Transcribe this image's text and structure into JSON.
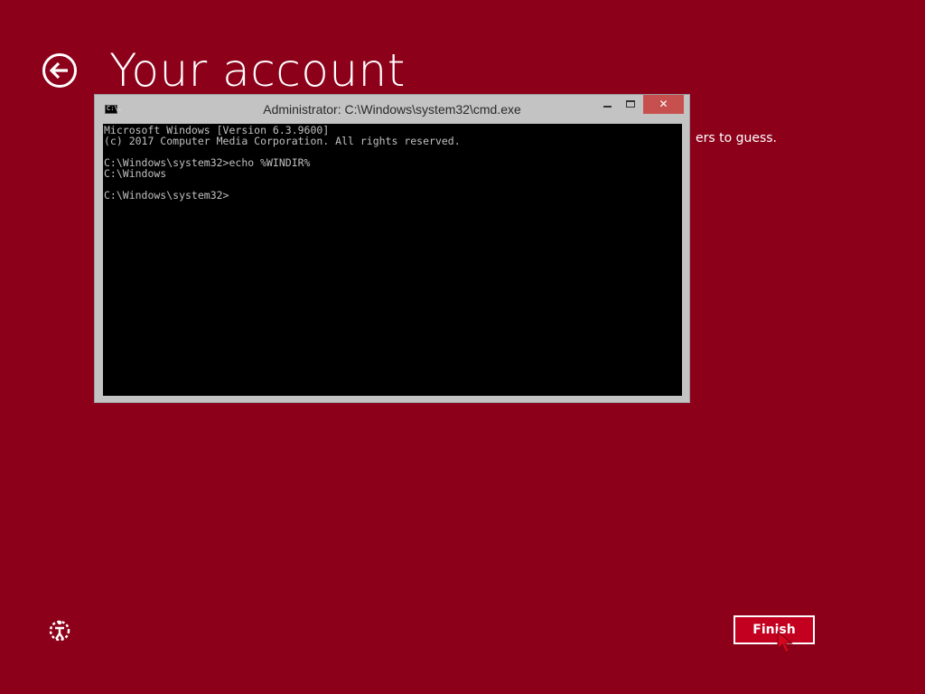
{
  "page": {
    "title": "Your account",
    "hint_text": "ers to guess.",
    "finish_label": "Finish",
    "background_color": "#8c001a",
    "icons": {
      "back": "back-arrow-icon",
      "ease_of_access": "ease-of-access-icon",
      "cursor": "mouse-pointer-icon"
    }
  },
  "cmd": {
    "icon_label": "C:\\.",
    "title": "Administrator: C:\\Windows\\system32\\cmd.exe",
    "close_glyph": "✕",
    "lines": [
      "Microsoft Windows [Version 6.3.9600]",
      "(c) 2017 Computer Media Corporation. All rights reserved.",
      "",
      "C:\\Windows\\system32>echo %WINDIR%",
      "C:\\Windows",
      "",
      "C:\\Windows\\system32>"
    ],
    "close_color": "#c7504f"
  }
}
